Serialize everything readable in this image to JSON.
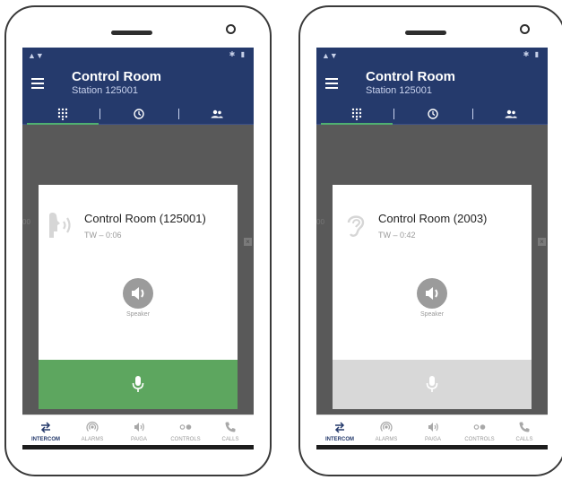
{
  "phones": [
    {
      "status_left": "▲▼",
      "status_right": "✱ ▮",
      "title": "Control Room",
      "subtitle": "Station 125001",
      "caller_name": "Control Room (125001)",
      "caller_sub": "TW – 0:06",
      "speaker_label": "Speaker",
      "caller_icon": "talking-head-icon",
      "ptt_state": "active"
    },
    {
      "status_left": "▲▼",
      "status_right": "✱ ▮",
      "title": "Control Room",
      "subtitle": "Station 125001",
      "caller_name": "Control Room (2003)",
      "caller_sub": "TW – 0:42",
      "speaker_label": "Speaker",
      "caller_icon": "ear-icon",
      "ptt_state": "inactive"
    }
  ],
  "nav": [
    "INTERCOM",
    "ALARMS",
    "PA/GA",
    "CONTROLS",
    "CALLS"
  ],
  "colors": {
    "appbar": "#253a6c",
    "accent_green": "#5da65f",
    "ptt_inactive": "#d8d8d8",
    "screen_bg": "#595959"
  }
}
